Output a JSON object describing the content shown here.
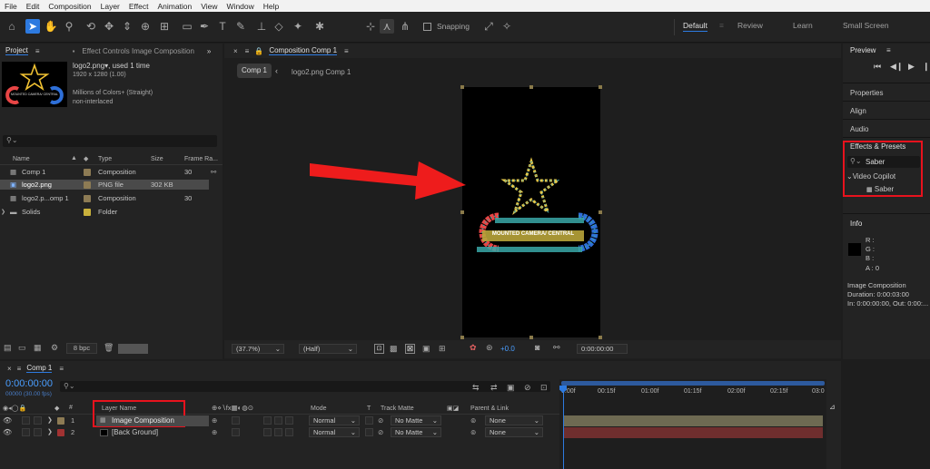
{
  "menu": [
    "File",
    "Edit",
    "Composition",
    "Layer",
    "Effect",
    "Animation",
    "View",
    "Window",
    "Help"
  ],
  "toolbar": {
    "snapping_label": "Snapping",
    "workspaces": [
      "Default",
      "Review",
      "Learn",
      "Small Screen"
    ],
    "active_workspace": "Default"
  },
  "project": {
    "tab_project": "Project",
    "tab_effect_controls": "Effect Controls Image Composition",
    "item_name": "logo2.png",
    "used": ", used 1 time",
    "dimensions": "1920 x 1280 (1.00)",
    "colors": "Millions of Colors+ (Straight)",
    "interlace": "non-interlaced",
    "thumb_text": "MOUNTED CAMERA/ CENTRAL",
    "columns": {
      "name": "Name",
      "type": "Type",
      "size": "Size",
      "frame_rate": "Frame Ra..."
    },
    "rows": [
      {
        "name": "Comp 1",
        "type": "Composition",
        "size": "",
        "fr": "30",
        "color": "#8d7b54"
      },
      {
        "name": "logo2.png",
        "type": "PNG file",
        "size": "302 KB",
        "fr": "",
        "color": "#8d7b54"
      },
      {
        "name": "logo2.p...omp 1",
        "type": "Composition",
        "size": "",
        "fr": "30",
        "color": "#8d7b54"
      },
      {
        "name": "Solids",
        "type": "Folder",
        "size": "",
        "fr": "",
        "color": "#c9b13c"
      }
    ],
    "bpc": "8 bpc"
  },
  "composition": {
    "tab_title": "Composition Comp 1",
    "crumb_active": "Comp 1",
    "crumb_next": "logo2.png Comp 1",
    "logo_text": "MOUNTED CAMERA/ CENTRAL",
    "zoom": "(37.7%)",
    "resolution": "(Half)",
    "exposure": "+0.0",
    "timecode": "0:00:00:00"
  },
  "right_panel": {
    "preview": "Preview",
    "properties": "Properties",
    "align": "Align",
    "audio": "Audio",
    "effects_presets": "Effects & Presets",
    "search_value": "Saber",
    "folder": "Video Copilot",
    "effect": "Saber",
    "info": "Info",
    "r": "R :",
    "g": "G :",
    "b": "B :",
    "a": "A :  0",
    "info_name": "Image Composition",
    "info_duration": "Duration: 0:00:03:00",
    "info_inout": "In: 0:00:00:00, Out: 0:00:..."
  },
  "timeline": {
    "tab": "Comp 1",
    "timecode": "0:00:00:00",
    "fps": "00000 (30.00 fps)",
    "col_layer_name": "Layer Name",
    "col_mode": "Mode",
    "col_t": "T",
    "col_track_matte": "Track Matte",
    "col_parent": "Parent & Link",
    "ruler": [
      "0:00f",
      "00:15f",
      "01:00f",
      "01:15f",
      "02:00f",
      "02:15f",
      "03:0"
    ],
    "layers": [
      {
        "num": "1",
        "name": "Image Composition",
        "mode": "Normal",
        "matte": "No Matte",
        "parent": "None",
        "color": "#8d7b54"
      },
      {
        "num": "2",
        "name": "[Back Ground]",
        "mode": "Normal",
        "matte": "No Matte",
        "parent": "None",
        "color": "#a13232"
      }
    ]
  },
  "colors": {
    "accent": "#2d7ae0",
    "highlight": "#e8121d",
    "track1": "#6e6a52",
    "track2": "#6f2e2e"
  }
}
